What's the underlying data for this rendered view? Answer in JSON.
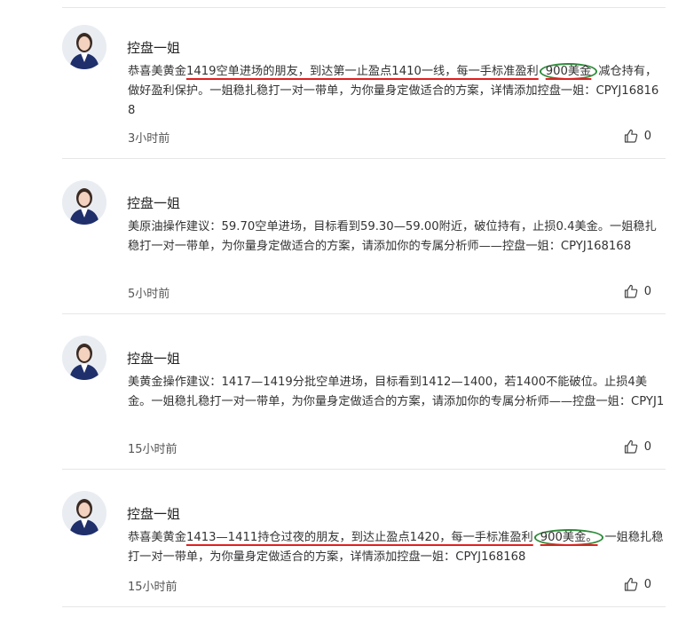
{
  "colors": {
    "underline": "#e02020",
    "highlight_circle": "#2e8b3a",
    "divider": "#e6e6e6"
  },
  "comments": [
    {
      "author": "控盘一姐",
      "text": {
        "pre": "恭喜美黄金",
        "underlined": "1419空单进场的朋友，到达第一止盈点1410一线，每一手标准盈利",
        "circled": "900美金",
        "post": "减仓持有，做好盈利保护。一姐稳扎稳打一对一带单，为你量身定做适合的方案，详情添加控盘一姐：CPYJ168168"
      },
      "time": "3小时前",
      "likes": "0",
      "like_icon": "thumbs-up-icon"
    },
    {
      "author": "控盘一姐",
      "text": {
        "plain": "美原油操作建议：59.70空单进场，目标看到59.30—59.00附近，破位持有，止损0.4美金。一姐稳扎稳打一对一带单，为你量身定做适合的方案，请添加你的专属分析师——控盘一姐：CPYJ168168"
      },
      "time": "5小时前",
      "likes": "0",
      "like_icon": "thumbs-up-icon"
    },
    {
      "author": "控盘一姐",
      "text": {
        "plain": "美黄金操作建议：1417—1419分批空单进场，目标看到1412—1400，若1400不能破位。止损4美金。一姐稳扎稳打一对一带单，为你量身定做适合的方案，请添加你的专属分析师——控盘一姐：CPYJ1"
      },
      "time": "15小时前",
      "likes": "0",
      "like_icon": "thumbs-up-icon"
    },
    {
      "author": "控盘一姐",
      "text": {
        "pre": "恭喜美黄金",
        "underlined": "1413—1411持仓过夜的朋友，到达止盈点1420，每一手标准盈利",
        "circled": "900美金。",
        "post": "一姐稳扎稳打一对一带单，为你量身定做适合的方案，详情添加控盘一姐：CPYJ168168"
      },
      "time": "15小时前",
      "likes": "0",
      "like_icon": "thumbs-up-icon"
    }
  ]
}
